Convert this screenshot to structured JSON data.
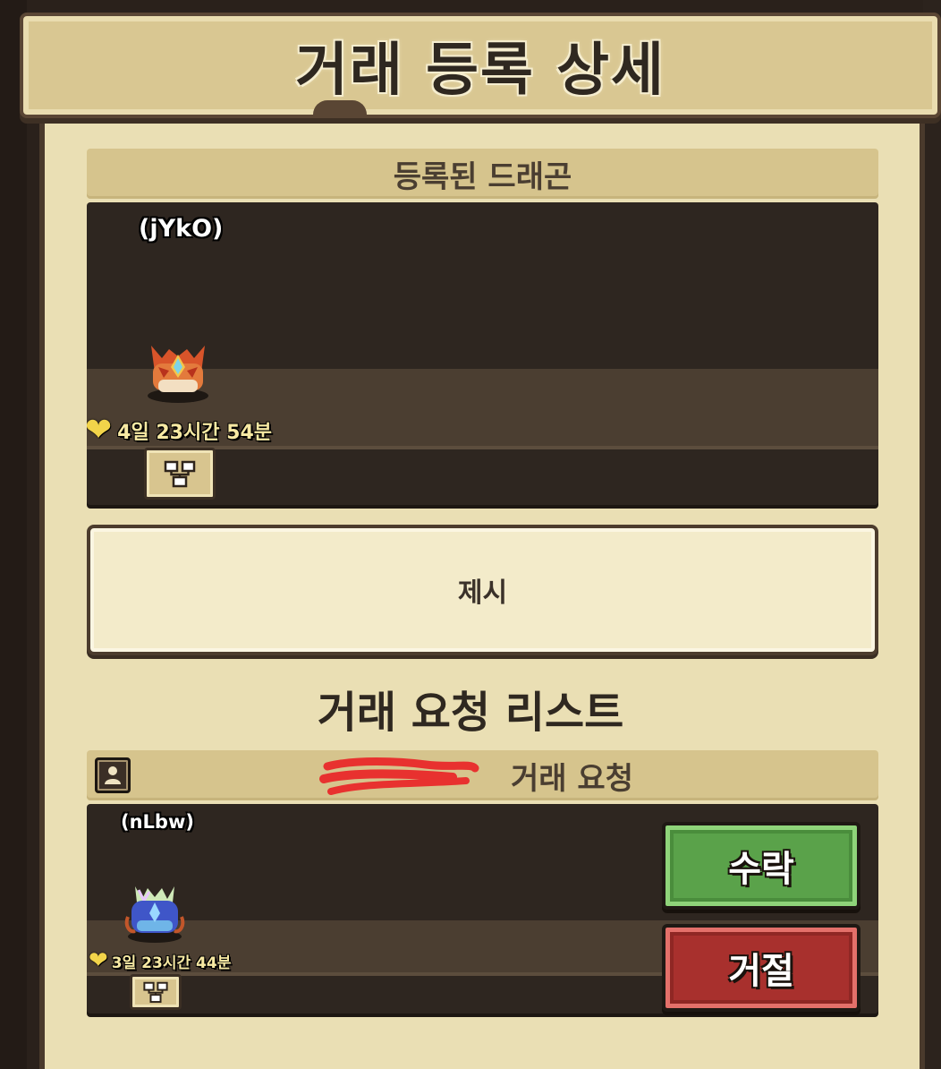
{
  "header": {
    "title": "거래 등록 상세"
  },
  "registered": {
    "section_label": "등록된 드래곤",
    "dragon": {
      "name": "(jYkO)",
      "life": "4일 23시간 54분"
    }
  },
  "offer": {
    "label": "제시"
  },
  "requests": {
    "title": "거래 요청 리스트",
    "header_suffix": "거래 요청",
    "items": [
      {
        "dragon_name": "(nLbw)",
        "life": "3일 23시간 44분",
        "accept_label": "수락",
        "reject_label": "거절"
      }
    ]
  },
  "icons": {
    "heart": "heart-icon",
    "tree": "family-tree-icon",
    "profile": "profile-icon"
  },
  "colors": {
    "accept": "#5aa24a",
    "reject": "#a8302d",
    "panel": "#eadfb4"
  }
}
